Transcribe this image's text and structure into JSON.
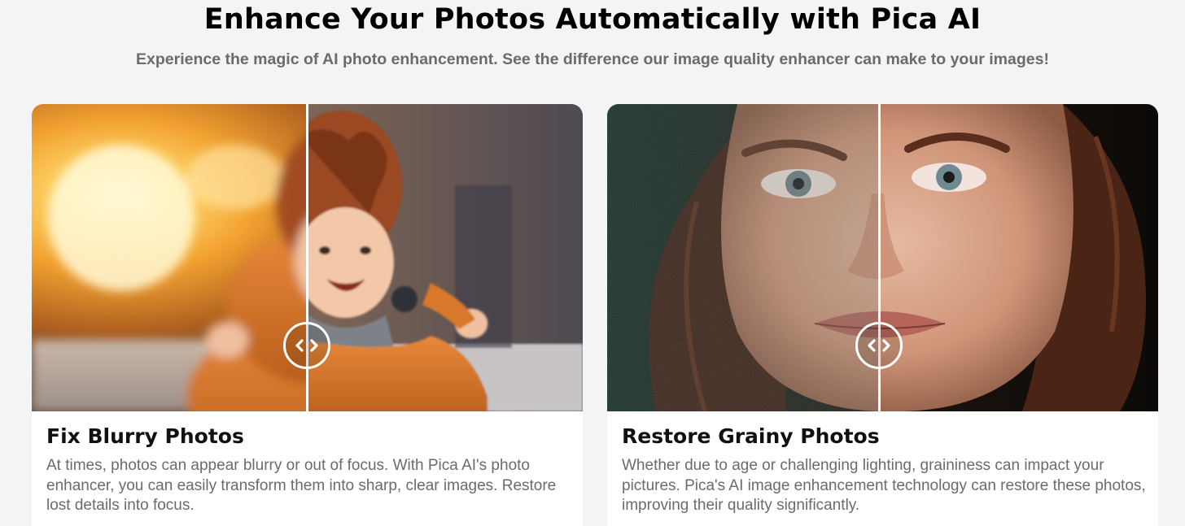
{
  "header": {
    "title": "Enhance Your Photos Automatically with Pica AI",
    "subtitle": "Experience the magic of AI photo enhancement. See the difference our image quality enhancer can make to your images!"
  },
  "cards": [
    {
      "title": "Fix Blurry Photos",
      "description": "At times, photos can appear blurry or out of focus. With Pica AI's photo enhancer, you can easily transform them into sharp, clear images. Restore lost details into focus.",
      "image_subject": "laughing toddler in orange jacket running at sunset",
      "handle_icon": "chevron-left-right-icon"
    },
    {
      "title": "Restore Grainy Photos",
      "description": "Whether due to age or challenging lighting, graininess can impact your pictures. Pica's AI image enhancement technology can restore these photos, improving their quality significantly.",
      "image_subject": "close-up portrait of freckled woman with auburn hair",
      "handle_icon": "chevron-left-right-icon"
    }
  ],
  "colors": {
    "background": "#f3f4f6",
    "card": "#ffffff",
    "title": "#111111",
    "muted_text": "#6b6b6b"
  }
}
